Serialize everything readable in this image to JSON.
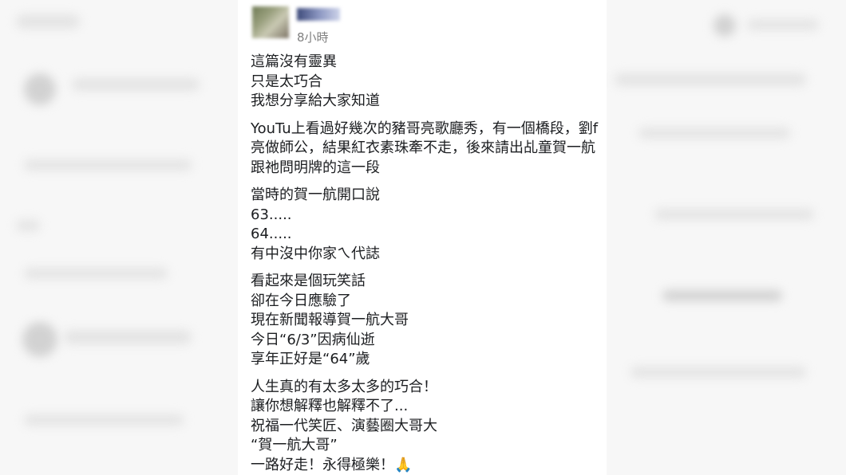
{
  "post": {
    "timestamp": "8小時",
    "paragraphs": [
      [
        "這篇沒有靈異",
        "只是太巧合",
        "我想分享給大家知道"
      ],
      [
        "YouTu上看過好幾次的豬哥亮歌廳秀，有一個橋段，劉f",
        "亮做師公，結果紅衣素珠牽不走，後來請出乩童賀一航",
        "跟祂問明牌的這一段"
      ],
      [
        "當時的賀一航開口說",
        "63.....",
        "64.....",
        "有中沒中你家ㄟ代誌"
      ],
      [
        "看起來是個玩笑話",
        "卻在今日應驗了",
        "現在新聞報導賀一航大哥",
        "今日“6/3”因病仙逝",
        "享年正好是“64”歲"
      ],
      [
        "人生真的有太多太多的巧合！",
        "讓你想解釋也解釋不了...",
        "祝福一代笑匠、演藝圈大哥大",
        "“賀一航大哥”",
        "一路好走！永得極樂！"
      ]
    ],
    "closing_emoji": "🙏",
    "emoji_icon": "folded-hands-icon"
  }
}
